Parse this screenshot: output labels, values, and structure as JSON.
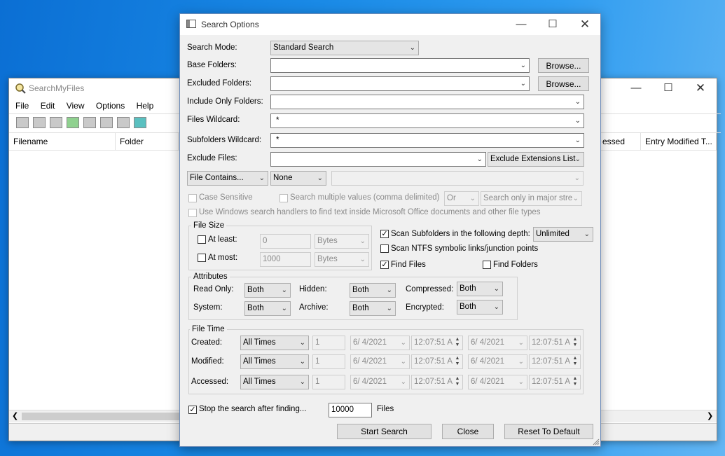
{
  "main_window": {
    "title": "SearchMyFiles",
    "menu": [
      "File",
      "Edit",
      "View",
      "Options",
      "Help"
    ],
    "columns": [
      "Filename",
      "Folder",
      "essed Ti...",
      "Entry Modified T..."
    ]
  },
  "dialog": {
    "title": "Search Options",
    "search_mode": {
      "label": "Search Mode:",
      "value": "Standard Search"
    },
    "base_folders": {
      "label": "Base Folders:",
      "value": "",
      "browse": "Browse..."
    },
    "excluded_folders": {
      "label": "Excluded Folders:",
      "value": "",
      "browse": "Browse..."
    },
    "include_only_folders": {
      "label": "Include Only Folders:",
      "value": ""
    },
    "files_wildcard": {
      "label": "Files Wildcard:",
      "value": "*"
    },
    "subfolders_wildcard": {
      "label": "Subfolders Wildcard:",
      "value": "*"
    },
    "exclude_files": {
      "label": "Exclude Files:",
      "value": "",
      "list": "Exclude Extensions List"
    },
    "file_contains": {
      "mode": "File Contains...",
      "encoding": "None",
      "text": ""
    },
    "case_sensitive": {
      "label": "Case Sensitive",
      "checked": false
    },
    "multiple_values": {
      "label": "Search multiple values (comma delimited)",
      "checked": false,
      "op": "Or",
      "scope": "Search only in major stre"
    },
    "windows_handlers": {
      "label": "Use Windows search handlers to find text inside Microsoft Office documents and other file types",
      "checked": false
    },
    "file_size": {
      "title": "File Size",
      "at_least": {
        "label": "At least:",
        "value": "0",
        "unit": "Bytes",
        "checked": false
      },
      "at_most": {
        "label": "At most:",
        "value": "1000",
        "unit": "Bytes",
        "checked": false
      }
    },
    "scan_subfolders": {
      "label": "Scan Subfolders in the following depth:",
      "checked": true,
      "depth": "Unlimited"
    },
    "scan_ntfs": {
      "label": "Scan NTFS symbolic links/junction points",
      "checked": false
    },
    "find_files": {
      "label": "Find Files",
      "checked": true
    },
    "find_folders": {
      "label": "Find Folders",
      "checked": false
    },
    "attributes": {
      "title": "Attributes",
      "read_only": {
        "label": "Read Only:",
        "value": "Both"
      },
      "hidden": {
        "label": "Hidden:",
        "value": "Both"
      },
      "compressed": {
        "label": "Compressed:",
        "value": "Both"
      },
      "system": {
        "label": "System:",
        "value": "Both"
      },
      "archive": {
        "label": "Archive:",
        "value": "Both"
      },
      "encrypted": {
        "label": "Encrypted:",
        "value": "Both"
      }
    },
    "file_time": {
      "title": "File Time",
      "rows": [
        {
          "label": "Created:",
          "mode": "All Times",
          "count": "1",
          "date1": "6/  4/2021",
          "time1": "12:07:51 A",
          "date2": "6/  4/2021",
          "time2": "12:07:51 A"
        },
        {
          "label": "Modified:",
          "mode": "All Times",
          "count": "1",
          "date1": "6/  4/2021",
          "time1": "12:07:51 A",
          "date2": "6/  4/2021",
          "time2": "12:07:51 A"
        },
        {
          "label": "Accessed:",
          "mode": "All Times",
          "count": "1",
          "date1": "6/  4/2021",
          "time1": "12:07:51 A",
          "date2": "6/  4/2021",
          "time2": "12:07:51 A"
        }
      ]
    },
    "stop_after": {
      "label": "Stop the search after finding...",
      "checked": true,
      "value": "10000",
      "suffix": "Files"
    },
    "buttons": {
      "start": "Start Search",
      "close": "Close",
      "reset": "Reset To Default"
    }
  }
}
